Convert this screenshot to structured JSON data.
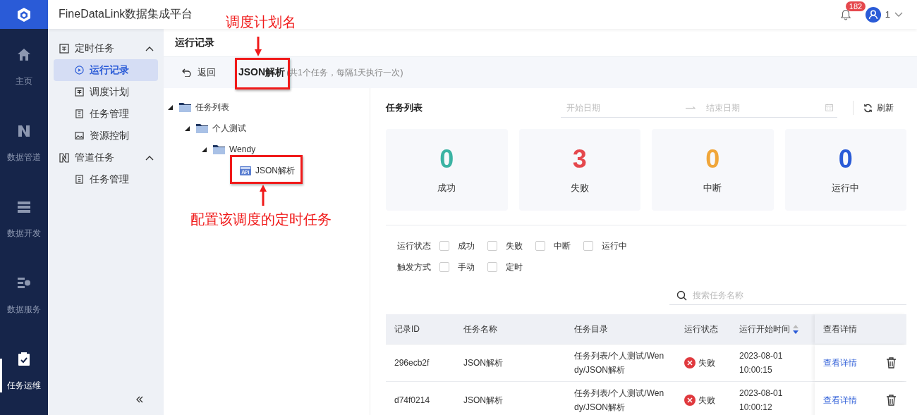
{
  "app": {
    "title": "FineDataLink数据集成平台",
    "notifications": "182",
    "user": "1"
  },
  "nav": [
    {
      "label": "主页",
      "selected": false
    },
    {
      "label": "数据管道",
      "selected": false
    },
    {
      "label": "数据开发",
      "selected": false
    },
    {
      "label": "数据服务",
      "selected": false
    },
    {
      "label": "任务运维",
      "selected": true
    }
  ],
  "sidebar": {
    "groups": [
      {
        "label": "定时任务",
        "expanded": true,
        "items": [
          {
            "label": "运行记录",
            "selected": true
          },
          {
            "label": "调度计划",
            "selected": false
          },
          {
            "label": "任务管理",
            "selected": false
          },
          {
            "label": "资源控制",
            "selected": false
          }
        ]
      },
      {
        "label": "管道任务",
        "expanded": true,
        "items": [
          {
            "label": "任务管理",
            "selected": false
          }
        ]
      }
    ]
  },
  "page": {
    "title": "运行记录",
    "back": "返回",
    "plan_name": "JSON解析",
    "plan_info": "(共1个任务，每隔1天执行一次)"
  },
  "tree": [
    {
      "label": "任务列表",
      "kind": "folder",
      "expanded": true,
      "children": [
        {
          "label": "个人测试",
          "kind": "folder",
          "expanded": true,
          "children": [
            {
              "label": "Wendy",
              "kind": "folder",
              "expanded": true,
              "children": [
                {
                  "label": "JSON解析",
                  "kind": "api"
                }
              ]
            }
          ]
        }
      ]
    }
  ],
  "task_list": {
    "title": "任务列表",
    "start_placeholder": "开始日期",
    "end_placeholder": "结束日期",
    "refresh": "刷新"
  },
  "stats": [
    {
      "value": "0",
      "label": "成功",
      "color": "#3bb3a3"
    },
    {
      "value": "3",
      "label": "失败",
      "color": "#e5484d"
    },
    {
      "value": "0",
      "label": "中断",
      "color": "#f0a63a"
    },
    {
      "value": "0",
      "label": "运行中",
      "color": "#2a5bd7"
    }
  ],
  "filters": [
    {
      "label": "运行状态",
      "options": [
        {
          "label": "成功",
          "checked": false
        },
        {
          "label": "失败",
          "checked": false
        },
        {
          "label": "中断",
          "checked": false
        },
        {
          "label": "运行中",
          "checked": false
        }
      ]
    },
    {
      "label": "触发方式",
      "options": [
        {
          "label": "手动",
          "checked": false
        },
        {
          "label": "定时",
          "checked": false
        }
      ]
    }
  ],
  "search": {
    "placeholder": "搜索任务名称"
  },
  "table": {
    "columns": [
      {
        "label": "记录ID"
      },
      {
        "label": "任务名称"
      },
      {
        "label": "任务目录"
      },
      {
        "label": "运行状态"
      },
      {
        "label": "运行开始时间",
        "sorted": true
      },
      {
        "label": "查看详情"
      }
    ],
    "rows": [
      {
        "id": "296ecb2f",
        "name": "JSON解析",
        "path": "任务列表/个人测试/Wendy/JSON解析",
        "status": "失败",
        "kind": "failed",
        "start": "2023-08-01 10:00:15",
        "link": "查看详情"
      },
      {
        "id": "d74f0214",
        "name": "JSON解析",
        "path": "任务列表/个人测试/Wendy/JSON解析",
        "status": "失败",
        "kind": "failed",
        "start": "2023-08-01 10:00:12",
        "link": "查看详情"
      }
    ]
  },
  "annotations": [
    {
      "text": "调度计划名"
    },
    {
      "text": "配置该调度的定时任务"
    }
  ]
}
